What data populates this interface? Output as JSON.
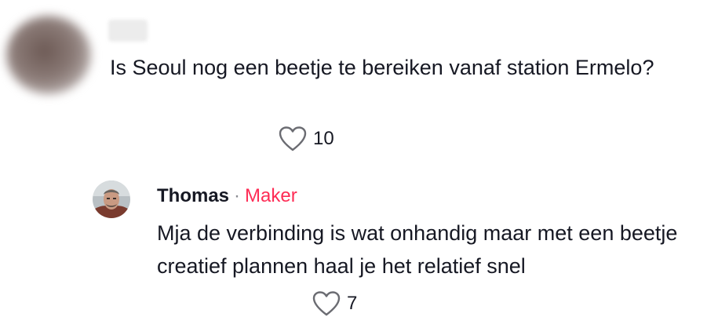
{
  "comment": {
    "text": "Is Seoul nog een beetje te bereiken vanaf station Ermelo?",
    "likes": "10"
  },
  "reply": {
    "author": "Thomas",
    "separator": "·",
    "badge": "Maker",
    "text": "Mja de verbinding is wat onhandig maar met een beetje creatief plannen haal je het relatief snel",
    "likes": "7"
  },
  "colors": {
    "badge": "#fe2c55",
    "text": "#161823"
  }
}
